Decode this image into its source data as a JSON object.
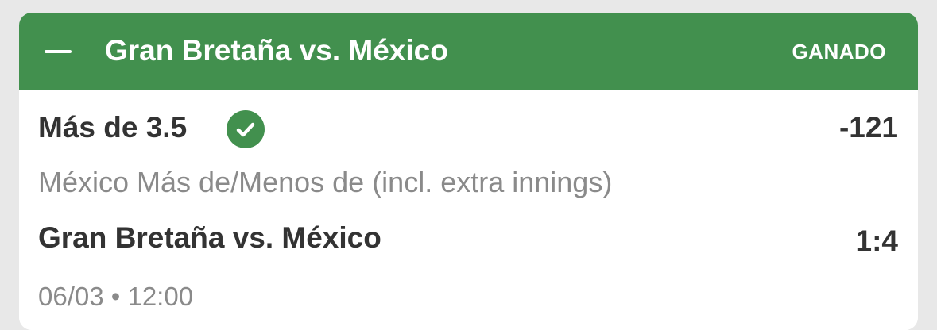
{
  "bet": {
    "header": {
      "title": "Gran Bretaña vs. México",
      "status": "GANADO",
      "collapse_icon": "minus-icon"
    },
    "selection": {
      "label": "Más de 3.5",
      "result_icon": "check-circle-icon",
      "odds": "-121"
    },
    "market": "México Más de/Menos de (incl. extra innings)",
    "event": {
      "name": "Gran Bretaña vs. México",
      "score": "1:4"
    },
    "datetime": "06/03 • 12:00"
  },
  "colors": {
    "header_green": "#42904e",
    "primary_text": "#333333",
    "secondary_text": "#8a8a8a",
    "background": "#e8e8e8"
  }
}
